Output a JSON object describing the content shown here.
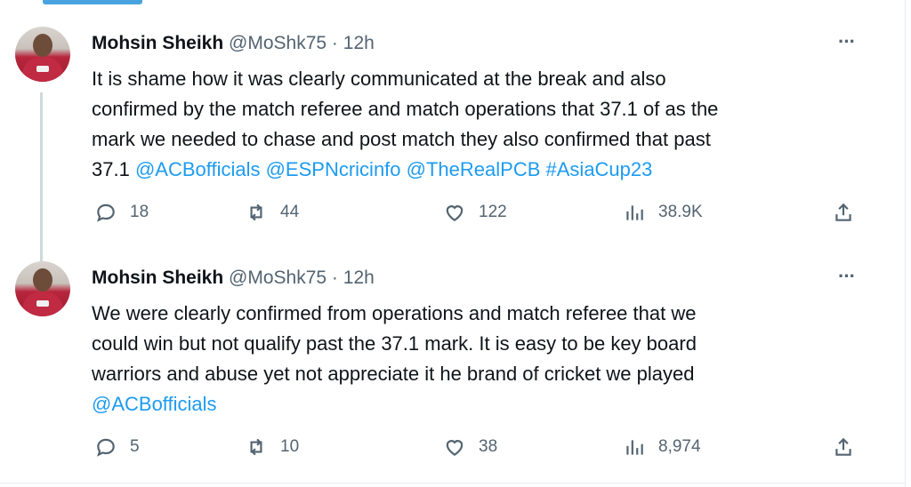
{
  "tweets": [
    {
      "author": "Mohsin Sheikh",
      "handle": "@MoShk75",
      "separator": "·",
      "time": "12h",
      "text_lines": [
        "It is shame how it was clearly communicated at the break and also",
        "confirmed by the match referee and match operations that 37.1 of as the",
        "mark we needed to chase and post match they also confirmed that past"
      ],
      "last_line_prefix": "37.1 ",
      "mentions": [
        "@ACBofficials",
        "@ESPNcricinfo",
        "@TheRealPCB",
        "#AsiaCup23"
      ],
      "replies": "18",
      "retweets": "44",
      "likes": "122",
      "views": "38.9K"
    },
    {
      "author": "Mohsin Sheikh",
      "handle": "@MoShk75",
      "separator": "·",
      "time": "12h",
      "text_lines": [
        "We were clearly confirmed from operations and match referee that we",
        "could win but not qualify past the 37.1 mark. It is easy to be key board",
        "warriors and abuse yet not appreciate it he brand of cricket we played"
      ],
      "mentions": [
        "@ACBofficials"
      ],
      "replies": "5",
      "retweets": "10",
      "likes": "38",
      "views": "8,974"
    }
  ],
  "icons": {
    "more": "more-icon",
    "reply": "reply-icon",
    "retweet": "retweet-icon",
    "like": "heart-icon",
    "views": "views-icon",
    "share": "share-icon"
  },
  "colors": {
    "link": "#1d9bf0",
    "secondary_text": "#536471",
    "primary_text": "#0f1419"
  }
}
